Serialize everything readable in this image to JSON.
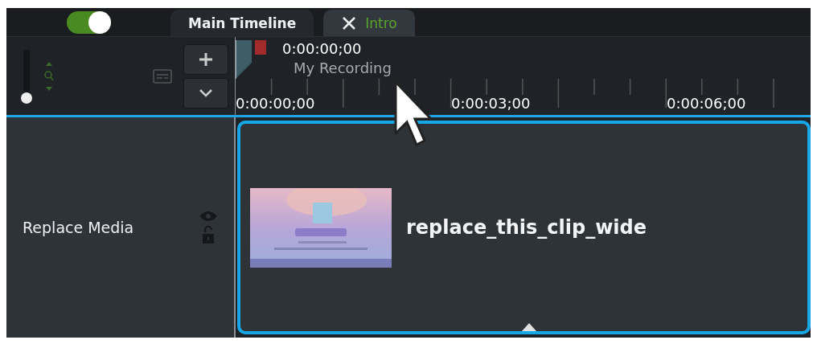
{
  "toggle": {
    "on": true
  },
  "tabs": [
    {
      "label": "Main Timeline",
      "selected": false,
      "closable": false
    },
    {
      "label": "Intro",
      "selected": true,
      "closable": true
    }
  ],
  "zoom_slider": {
    "level": 0.05
  },
  "playhead": {
    "time": "0:00:00;00",
    "recording": "My Recording"
  },
  "ruler": {
    "labels": [
      "0:00:00;00",
      "0:00:03;00",
      "0:00:06;00"
    ]
  },
  "track": {
    "name": "Replace Media",
    "visible": true,
    "locked": false,
    "clip": {
      "name": "replace_this_clip_wide",
      "selected": true,
      "kind": "picture"
    }
  }
}
